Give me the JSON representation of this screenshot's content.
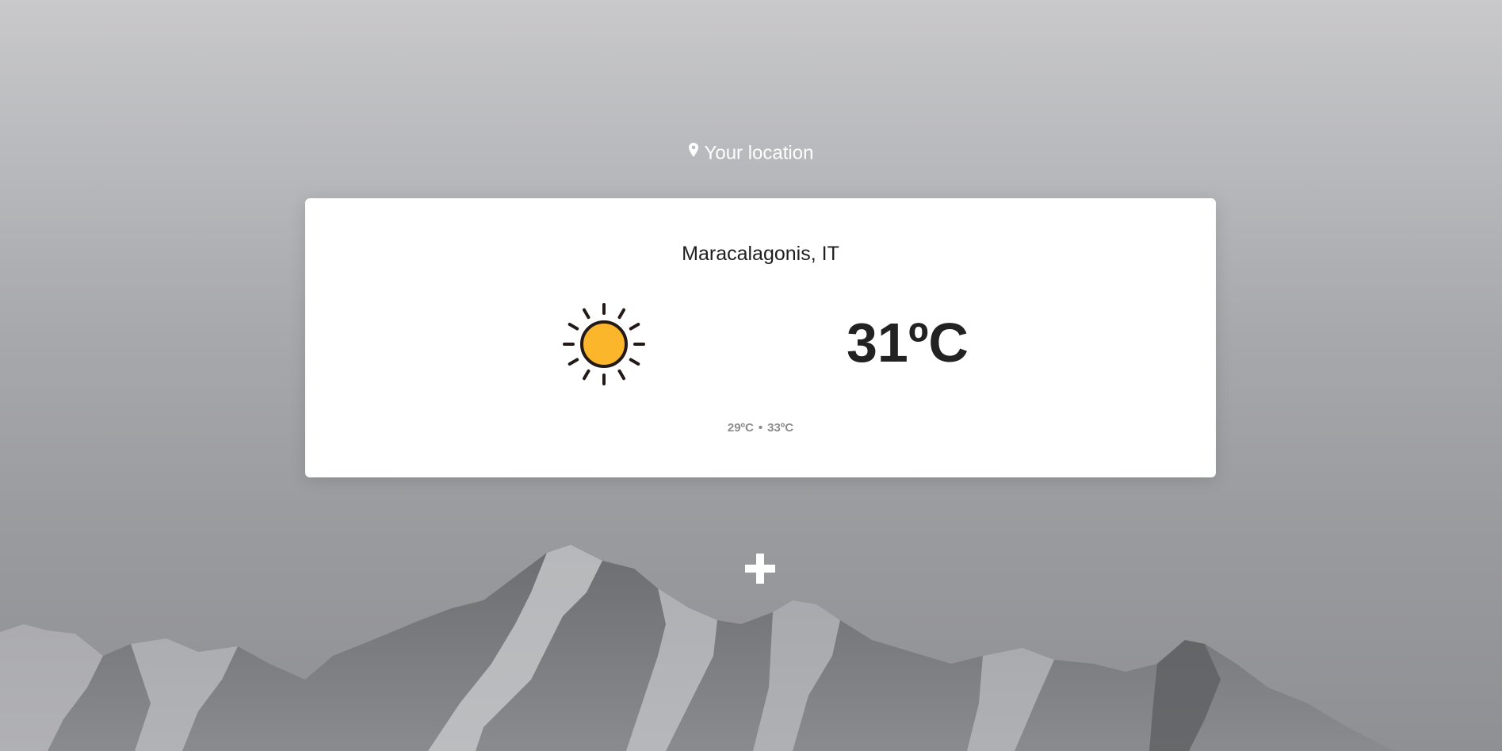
{
  "header": {
    "location_label": "Your location",
    "location_icon": "map-pin-icon"
  },
  "card": {
    "city": "Maracalagonis, IT",
    "condition_icon": "sun-icon",
    "temperature": "31ºC",
    "min_temp": "29ºC",
    "separator": "•",
    "max_temp": "33ºC"
  },
  "actions": {
    "add_icon": "plus-icon"
  },
  "colors": {
    "sun_fill": "#fbb62c",
    "outline": "#231916",
    "text_dark": "#222222",
    "text_muted": "#8a8a8a"
  }
}
